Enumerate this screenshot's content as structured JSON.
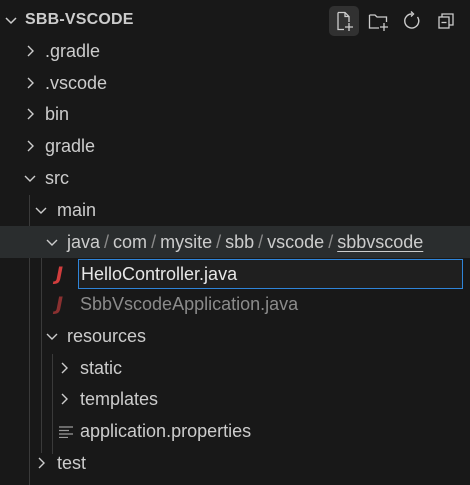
{
  "header": {
    "title": "SBB-VSCODE",
    "actions": [
      {
        "name": "new-file-icon",
        "tooltip": "New File"
      },
      {
        "name": "new-folder-icon",
        "tooltip": "New Folder"
      },
      {
        "name": "refresh-icon",
        "tooltip": "Refresh Explorer"
      },
      {
        "name": "collapse-all-icon",
        "tooltip": "Collapse Folders in Explorer"
      }
    ]
  },
  "tree": {
    "gradle_hidden": ".gradle",
    "vscode": ".vscode",
    "bin": "bin",
    "gradle": "gradle",
    "src": "src",
    "main": "main",
    "java_path": [
      "java",
      "com",
      "mysite",
      "sbb",
      "vscode",
      "sbbvscode"
    ],
    "path_separator": "/",
    "rename_value": "HelloController.java",
    "app_file": "SbbVscodeApplication.java",
    "resources": "resources",
    "static": "static",
    "templates": "templates",
    "props": "application.properties",
    "test": "test",
    "java_icon_glyph": "J"
  },
  "colors": {
    "background": "#181818",
    "selected_row": "#2a2d2e",
    "focus_border": "#2f84d8",
    "java_icon": "#d13d3d"
  }
}
